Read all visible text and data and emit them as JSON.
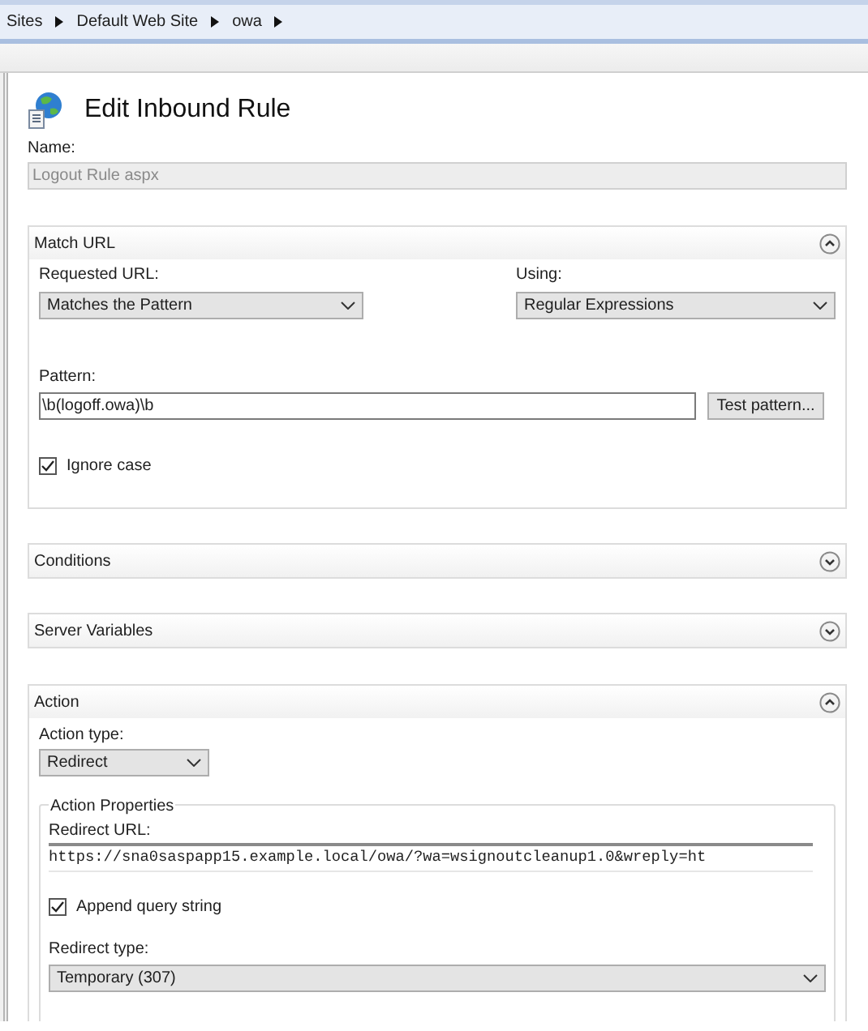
{
  "breadcrumb": [
    {
      "label": "Sites"
    },
    {
      "label": "Default Web Site"
    },
    {
      "label": "owa"
    }
  ],
  "title": "Edit Inbound Rule",
  "name_field": {
    "label": "Name:",
    "value": "Logout Rule aspx",
    "disabled": true
  },
  "sections": [
    {
      "kind": "match_url",
      "title": "Match URL",
      "expanded": true,
      "requested_url": {
        "label": "Requested URL:",
        "value": "Matches the Pattern"
      },
      "using": {
        "label": "Using:",
        "value": "Regular Expressions"
      },
      "pattern": {
        "label": "Pattern:",
        "value": "\\b(logoff.owa)\\b"
      },
      "test_button": "Test pattern...",
      "ignore_case": {
        "label": "Ignore case",
        "checked": true
      }
    },
    {
      "kind": "plain",
      "title": "Conditions",
      "expanded": false
    },
    {
      "kind": "plain",
      "title": "Server Variables",
      "expanded": false
    },
    {
      "kind": "action",
      "title": "Action",
      "expanded": true,
      "action_type": {
        "label": "Action type:",
        "value": "Redirect"
      },
      "properties": {
        "title": "Action Properties",
        "redirect_url": {
          "label": "Redirect URL:",
          "value": "https://sna0saspapp15.example.local/owa/?wa=wsignoutcleanup1.0&wreply=ht"
        },
        "append_query": {
          "label": "Append query string",
          "checked": true
        },
        "redirect_type": {
          "label": "Redirect type:",
          "value": "Temporary (307)"
        }
      }
    }
  ]
}
